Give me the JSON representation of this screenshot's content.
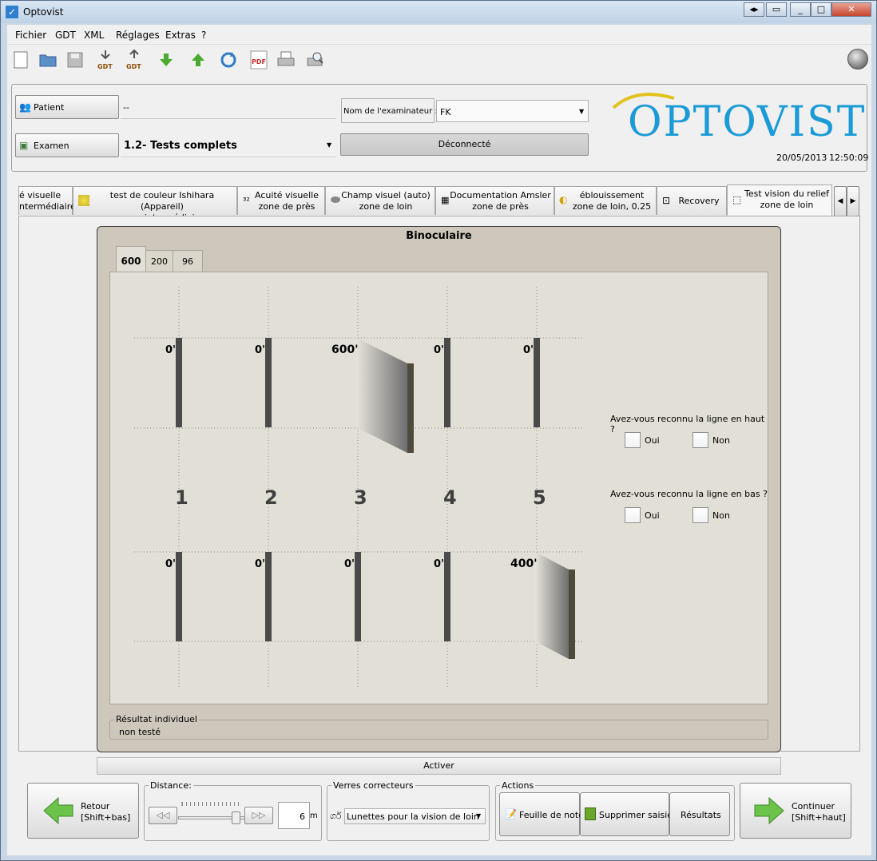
{
  "window": {
    "title": "Optovist"
  },
  "menu": [
    "Fichier",
    "GDT",
    "XML",
    "Réglages",
    "Extras",
    "?"
  ],
  "toolbar": {
    "icons": [
      "new-document-icon",
      "open-folder-icon",
      "save-icon",
      "gdt-import-icon",
      "gdt-export-icon",
      "arrow-down-icon",
      "arrow-up-icon",
      "refresh-icon",
      "pdf-icon",
      "print-icon",
      "print-preview-icon"
    ],
    "gdt_label": "GDT",
    "pdf_label": "PDF"
  },
  "header": {
    "patient_button": "Patient",
    "patient_value": "--",
    "examen_button": "Examen",
    "examen_value": "1.2- Tests complets",
    "examiner_label": "Nom de l'examinateur :",
    "examiner_value": "FK",
    "connection_status": "Déconnecté",
    "logo": "OPTOVIST",
    "date": "20/05/2013",
    "time": "12:50:09"
  },
  "tabs": [
    {
      "l1": "é visuelle",
      "l2": "ntermédiaire"
    },
    {
      "l1": "test de couleur Ishihara (Appareil)",
      "l2": "zone intermédiaire"
    },
    {
      "l1": "Acuité visuelle",
      "l2": "zone de près"
    },
    {
      "l1": "Champ visuel (auto)",
      "l2": "zone de loin"
    },
    {
      "l1": "Documentation Amsler",
      "l2": "zone de près"
    },
    {
      "l1": "éblouissement",
      "l2": "zone de loin, 0.25"
    },
    {
      "l1": "Recovery",
      "l2": ""
    },
    {
      "l1": "Test vision du relief",
      "l2": "zone de loin"
    }
  ],
  "test": {
    "title": "Binoculaire",
    "inner_tabs": [
      "600",
      "200",
      "96"
    ],
    "numbers": [
      "1",
      "2",
      "3",
      "4",
      "5"
    ],
    "top_row": [
      "0'",
      "0'",
      "600'",
      "0'",
      "0'"
    ],
    "bottom_row": [
      "0'",
      "0'",
      "0'",
      "0'",
      "400'"
    ],
    "question_top": "Avez-vous reconnu la ligne en haut ?",
    "question_bottom": "Avez-vous reconnu la ligne en bas ?",
    "oui": "Oui",
    "non": "Non",
    "result_title": "Résultat individuel",
    "result_value": "non testé"
  },
  "activer": "Activer",
  "bottom": {
    "retour_l1": "Retour",
    "retour_l2": "[Shift+bas]",
    "distance_title": "Distance:",
    "distance_value": "6",
    "distance_unit": "m",
    "verres_title": "Verres correcteurs",
    "verres_value": "Lunettes pour la vision de loin",
    "actions_title": "Actions",
    "feuille": "Feuille de note",
    "supprimer": "Supprimer saisies",
    "resultats": "Résultats",
    "continuer_l1": "Continuer",
    "continuer_l2": "[Shift+haut]"
  }
}
